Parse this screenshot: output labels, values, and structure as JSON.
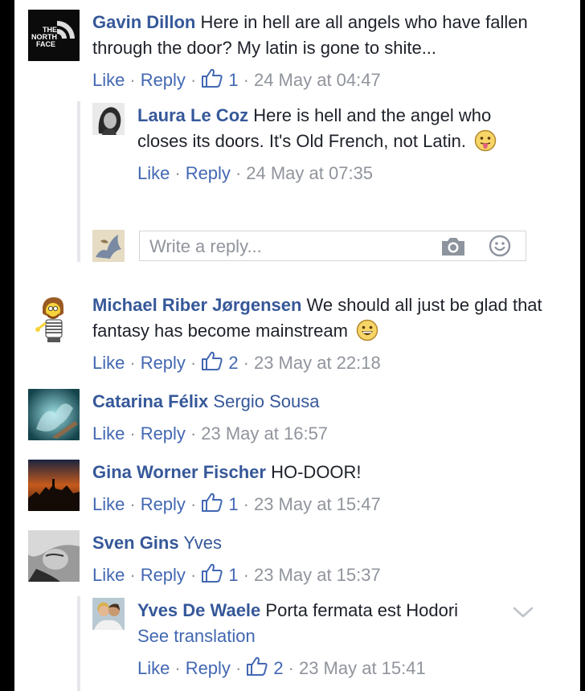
{
  "colors": {
    "author": "#365899",
    "link": "#4267b2",
    "meta": "#90949c",
    "text": "#1d2129"
  },
  "comments": [
    {
      "author": "Gavin Dillon",
      "text": "Here in hell are all angels who have fallen through the door? My latin is gone to shite...",
      "actions": {
        "like": "Like",
        "reply": "Reply",
        "likes": "1",
        "time": "24 May at 04:47"
      },
      "avatar_text": [
        "THE",
        "NORTH",
        "FACE"
      ],
      "replies": [
        {
          "author": "Laura Le Coz",
          "text": "Here is hell and the angel who closes its doors. It's Old French, not Latin.",
          "emoji": "tongue-out-emoji",
          "actions": {
            "like": "Like",
            "reply": "Reply",
            "time": "24 May at 07:35"
          }
        }
      ],
      "reply_placeholder": "Write a reply..."
    },
    {
      "author": "Michael Riber Jørgensen",
      "text": "We should all just be glad that fantasy has become mainstream",
      "emoji": "grin-emoji",
      "actions": {
        "like": "Like",
        "reply": "Reply",
        "likes": "2",
        "time": "23 May at 22:18"
      }
    },
    {
      "author": "Catarina Félix",
      "mention": "Sergio Sousa",
      "actions": {
        "like": "Like",
        "reply": "Reply",
        "time": "23 May at 16:57"
      }
    },
    {
      "author": "Gina Worner Fischer",
      "text": "HO-DOOR!",
      "actions": {
        "like": "Like",
        "reply": "Reply",
        "likes": "1",
        "time": "23 May at 15:47"
      }
    },
    {
      "author": "Sven Gins",
      "mention": "Yves",
      "actions": {
        "like": "Like",
        "reply": "Reply",
        "likes": "1",
        "time": "23 May at 15:37"
      },
      "replies": [
        {
          "author": "Yves De Waele",
          "text": "Porta fermata est Hodori",
          "see_translation": "See translation",
          "actions": {
            "like": "Like",
            "reply": "Reply",
            "likes": "2",
            "time": "23 May at 15:41"
          }
        }
      ]
    }
  ],
  "dot": "·"
}
